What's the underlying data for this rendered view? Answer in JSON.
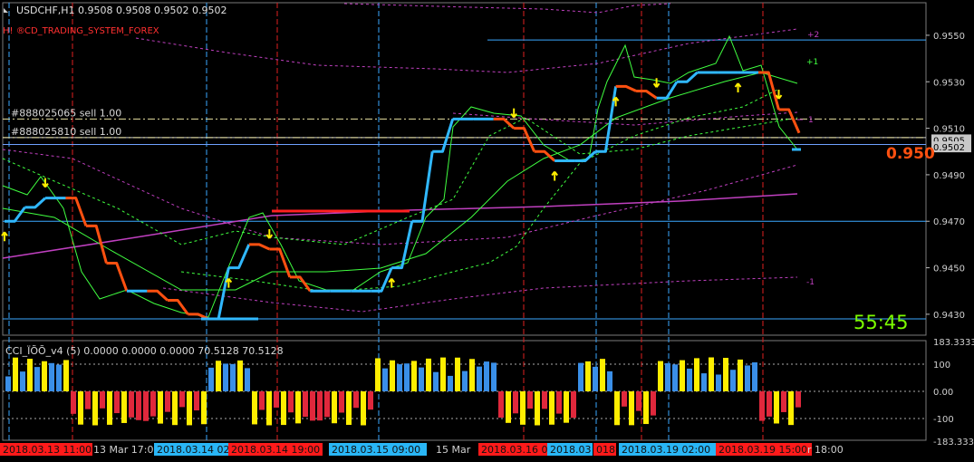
{
  "header": {
    "symbol_line": "USDCHF,H1  0.9508 0.9508 0.9502 0.9502",
    "indicator_name": "CD_TRADING_SYSTEM_FOREX"
  },
  "orders": [
    {
      "label": "#888025065 sell 1.00",
      "price": 0.9514
    },
    {
      "label": "#888025810 sell 1.00",
      "price": 0.9506
    }
  ],
  "price_tag": "0.950",
  "countdown": "55:45",
  "osc": {
    "title": "CCI_ÏÕÕ_v4 (5) 0.0000 0.0000 0.0000 70.5128 70.5128",
    "axis_labels": [
      "183.3333",
      "100",
      "0.00",
      "-100",
      "-183.3333"
    ],
    "axis_values": [
      183.3333,
      100,
      0,
      -100,
      -183.3333
    ]
  },
  "price_axis": {
    "labels": [
      "0.9550",
      "0.9530",
      "0.9510",
      "0.9505",
      "0.9502",
      "0.9490",
      "0.9470",
      "0.9450",
      "0.9430"
    ],
    "values": [
      0.955,
      0.953,
      0.951,
      0.9505,
      0.9502,
      0.949,
      0.947,
      0.945,
      0.943
    ]
  },
  "band_labels": [
    "+2",
    "+1",
    "-1"
  ],
  "time_axis": [
    {
      "label": "2018.03.13 11:00",
      "style": "red"
    },
    {
      "label": "13 Mar 17:00",
      "style": "plain"
    },
    {
      "label": "2018.03.14 02:00",
      "style": "blue"
    },
    {
      "label": "2018.03.14 19:00",
      "style": "red"
    },
    {
      "label": "2018.03.15 09:00",
      "style": "blue"
    },
    {
      "label": "15 Mar",
      "style": "plain"
    },
    {
      "label": "2018.03.16 0",
      "style": "red"
    },
    {
      "label": "2018.03",
      "style": "blue"
    },
    {
      "label": "018",
      "style": "red"
    },
    {
      "label": "2018.03.19 02:00",
      "style": "blue"
    },
    {
      "label": "2018.03.19 15:00",
      "style": "red"
    },
    {
      "label": "r 18:00",
      "style": "plain"
    }
  ],
  "colors": {
    "background": "#000000",
    "price_line": "#2fb8ff",
    "trend_orange": "#ff5010",
    "trend_blue": "#30b8ff",
    "signal_green": "#40ff40",
    "envelope": "#c040c0",
    "osc_up": "#3a8fe8",
    "osc_down": "#e0283c",
    "osc_extreme": "#ffee00",
    "arrow": "#ffee00",
    "countdown": "#7cfc00",
    "price_tag": "#ff5010"
  },
  "chart_data": {
    "type": "line",
    "symbol": "USDCHF",
    "timeframe": "H1",
    "ylim": [
      0.9421,
      0.9564
    ],
    "series": [
      {
        "name": "",
        "values": [
          0.947,
          0.9476,
          0.948,
          0.948,
          0.9468,
          0.9452,
          0.944,
          0.944,
          0.9436,
          0.943,
          0.9428,
          0.945,
          0.946,
          0.9458,
          0.9446,
          0.944,
          0.944,
          0.944,
          0.944,
          0.945,
          0.947,
          0.95,
          0.9514,
          0.9514,
          0.9514,
          0.951,
          0.95,
          0.9496,
          0.9496,
          0.95,
          0.9528,
          0.9526,
          0.9523,
          0.953,
          0.9534,
          0.9534,
          0.9534,
          0.9534,
          0.9518,
          0.9508
        ]
      },
      {
        "name": "",
        "values": [
          0.9464,
          0.947,
          0.9472,
          0.9468,
          0.9458,
          0.9448,
          0.9442,
          0.9438,
          0.9434,
          0.9432,
          0.9432,
          0.9438,
          0.9444,
          0.9448,
          0.9448,
          0.9446,
          0.9444,
          0.9444,
          0.9446,
          0.945,
          0.946,
          0.9476,
          0.949,
          0.95,
          0.9506,
          0.9508,
          0.9506,
          0.9502,
          0.95,
          0.9502,
          0.9512,
          0.9518,
          0.9522,
          0.9526,
          0.953,
          0.9532,
          0.9532,
          0.953,
          0.9524,
          0.9518
        ]
      }
    ],
    "arrows_up_index": [
      0,
      11,
      19,
      27,
      30,
      36
    ],
    "arrows_down_index": [
      2,
      13,
      25,
      32,
      38
    ]
  }
}
